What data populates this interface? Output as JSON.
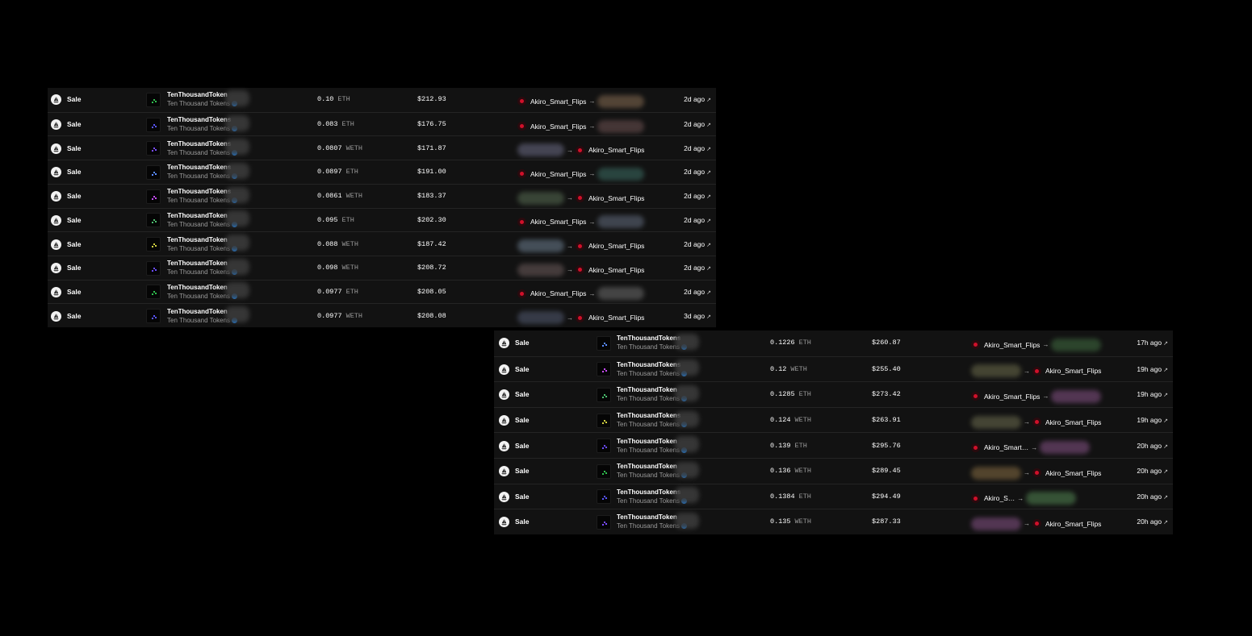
{
  "colors": {
    "background": "#000000",
    "panel": "#121212",
    "verified": "#2081e2",
    "avatar_dot": "#d0102a"
  },
  "icons": {
    "event": "sailboat-icon",
    "verified": "verified-badge-icon",
    "transfer": "arrow-right-icon",
    "external": "external-link-icon"
  },
  "panels": [
    {
      "rows": [
        {
          "event": "Sale",
          "item": "TenThousandToken",
          "collection": "Ten Thousand Tokens",
          "price": "0.10",
          "currency": "ETH",
          "usd": "$212.93",
          "from": "Akiro_Smart_Flips",
          "to": "",
          "time": "2d ago"
        },
        {
          "event": "Sale",
          "item": "TenThousandTokens",
          "collection": "Ten Thousand Tokens",
          "price": "0.083",
          "currency": "ETH",
          "usd": "$176.75",
          "from": "Akiro_Smart_Flips",
          "to": "",
          "time": "2d ago"
        },
        {
          "event": "Sale",
          "item": "TenThousandTokens",
          "collection": "Ten Thousand Tokens",
          "price": "0.0807",
          "currency": "WETH",
          "usd": "$171.87",
          "from": "",
          "to": "Akiro_Smart_Flips",
          "time": "2d ago"
        },
        {
          "event": "Sale",
          "item": "TenThousandTokens",
          "collection": "Ten Thousand Tokens",
          "price": "0.0897",
          "currency": "ETH",
          "usd": "$191.00",
          "from": "Akiro_Smart_Flips",
          "to": "",
          "time": "2d ago"
        },
        {
          "event": "Sale",
          "item": "TenThousandTokens",
          "collection": "Ten Thousand Tokens",
          "price": "0.0861",
          "currency": "WETH",
          "usd": "$183.37",
          "from": "",
          "to": "Akiro_Smart_Flips",
          "time": "2d ago"
        },
        {
          "event": "Sale",
          "item": "TenThousandToken",
          "collection": "Ten Thousand Tokens",
          "price": "0.095",
          "currency": "ETH",
          "usd": "$202.30",
          "from": "Akiro_Smart_Flips",
          "to": "",
          "time": "2d ago"
        },
        {
          "event": "Sale",
          "item": "TenThousandToken",
          "collection": "Ten Thousand Tokens",
          "price": "0.088",
          "currency": "WETH",
          "usd": "$187.42",
          "from": "",
          "to": "Akiro_Smart_Flips",
          "time": "2d ago"
        },
        {
          "event": "Sale",
          "item": "TenThousandToken",
          "collection": "Ten Thousand Tokens",
          "price": "0.098",
          "currency": "WETH",
          "usd": "$208.72",
          "from": "",
          "to": "Akiro_Smart_Flips",
          "time": "2d ago"
        },
        {
          "event": "Sale",
          "item": "TenThousandToken",
          "collection": "Ten Thousand Tokens",
          "price": "0.0977",
          "currency": "ETH",
          "usd": "$208.05",
          "from": "Akiro_Smart_Flips",
          "to": "",
          "time": "2d ago"
        },
        {
          "event": "Sale",
          "item": "TenThousandToken",
          "collection": "Ten Thousand Tokens",
          "price": "0.0977",
          "currency": "WETH",
          "usd": "$208.08",
          "from": "",
          "to": "Akiro_Smart_Flips",
          "time": "3d ago"
        }
      ]
    },
    {
      "rows": [
        {
          "event": "Sale",
          "item": "TenThousandTokens",
          "collection": "Ten Thousand Tokens",
          "price": "0.1226",
          "currency": "ETH",
          "usd": "$260.87",
          "from": "Akiro_Smart_Flips",
          "to": "",
          "time": "17h ago"
        },
        {
          "event": "Sale",
          "item": "TenThousandTokens",
          "collection": "Ten Thousand Tokens",
          "price": "0.12",
          "currency": "WETH",
          "usd": "$255.40",
          "from": "",
          "to": "Akiro_Smart_Flips",
          "time": "19h ago"
        },
        {
          "event": "Sale",
          "item": "TenThousandToken",
          "collection": "Ten Thousand Tokens",
          "price": "0.1285",
          "currency": "ETH",
          "usd": "$273.42",
          "from": "Akiro_Smart_Flips",
          "to": "",
          "time": "19h ago"
        },
        {
          "event": "Sale",
          "item": "TenThousandTokens",
          "collection": "Ten Thousand Tokens",
          "price": "0.124",
          "currency": "WETH",
          "usd": "$263.91",
          "from": "",
          "to": "Akiro_Smart_Flips",
          "time": "19h ago"
        },
        {
          "event": "Sale",
          "item": "TenThousandToken",
          "collection": "Ten Thousand Tokens",
          "price": "0.139",
          "currency": "ETH",
          "usd": "$295.76",
          "from": "Akiro_Smart…",
          "to": "",
          "time": "20h ago"
        },
        {
          "event": "Sale",
          "item": "TenThousandToken",
          "collection": "Ten Thousand Tokens",
          "price": "0.136",
          "currency": "WETH",
          "usd": "$289.45",
          "from": "",
          "to": "Akiro_Smart_Flips",
          "time": "20h ago"
        },
        {
          "event": "Sale",
          "item": "TenThousandTokens",
          "collection": "Ten Thousand Tokens",
          "price": "0.1384",
          "currency": "ETH",
          "usd": "$294.49",
          "from": "Akiro_S…",
          "to": "",
          "time": "20h ago"
        },
        {
          "event": "Sale",
          "item": "TenThousandToken",
          "collection": "Ten Thousand Tokens",
          "price": "0.135",
          "currency": "WETH",
          "usd": "$287.33",
          "from": "",
          "to": "Akiro_Smart_Flips",
          "time": "20h ago"
        }
      ]
    }
  ]
}
